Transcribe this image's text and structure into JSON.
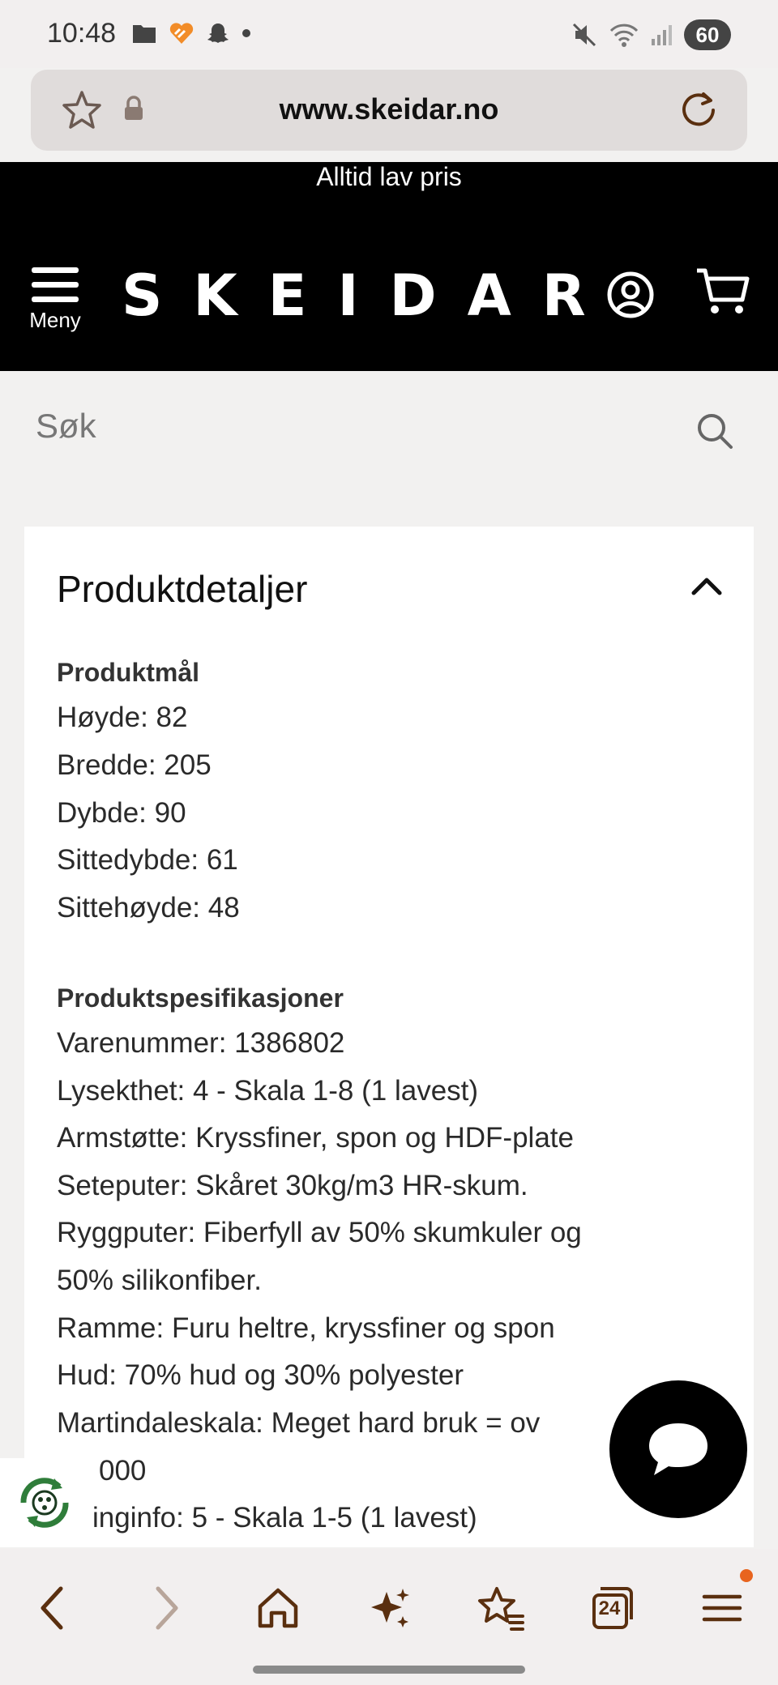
{
  "status_bar": {
    "time": "10:48",
    "battery": "60"
  },
  "browser": {
    "url": "www.skeidar.no"
  },
  "header": {
    "promo": "Alltid lav pris",
    "menu_label": "Meny",
    "logo": "SKEIDAR"
  },
  "search": {
    "placeholder": "Søk"
  },
  "product_details": {
    "title": "Produktdetaljer",
    "dimensions_heading": "Produktmål",
    "dimensions": [
      "Høyde: 82",
      "Bredde: 205",
      "Dybde: 90",
      "Sittedybde: 61",
      "Sittehøyde: 48"
    ],
    "specs_heading": "Produktspesifikasjoner",
    "specs": [
      "Varenummer: 1386802",
      "Lysekthet: 4 - Skala 1-8 (1 lavest)",
      "Armstøtte: Kryssfiner, spon og HDF-plate",
      "Seteputer: Skåret 30kg/m3 HR-skum.",
      "Ryggputer: Fiberfyll av 50% skumkuler og",
      "50% silikonfiber.",
      "Ramme: Furu heltre, kryssfiner og spon",
      "Hud: 70% hud og 30% polyester",
      "Martindaleskala: Meget hard bruk = ov",
      "000",
      "inginfo: 5 - Skala 1-5 (1 lavest)"
    ]
  },
  "bottom_nav": {
    "tab_count": "24"
  },
  "colors": {
    "accent": "#5a2f0f",
    "header_bg": "#000000",
    "notification_dot": "#e8641e"
  }
}
